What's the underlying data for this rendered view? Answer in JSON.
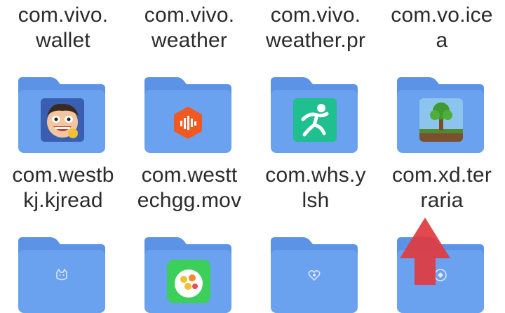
{
  "items": [
    {
      "label_l1": "com.vivo.",
      "label_l2": "wallet",
      "icon": "none"
    },
    {
      "label_l1": "com.vivo.",
      "label_l2": "weather",
      "icon": "none"
    },
    {
      "label_l1": "com.vivo.",
      "label_l2": "weather.pr",
      "icon": "none"
    },
    {
      "label_l1": "com.vo.ice",
      "label_l2": "a",
      "icon": "none"
    },
    {
      "label_l1": "com.westb",
      "label_l2": "kj.kjread",
      "icon": "cartoon-face-app-icon"
    },
    {
      "label_l1": "com.westt",
      "label_l2": "echgg.mov",
      "icon": "orange-podcast-app-icon"
    },
    {
      "label_l1": "com.whs.y",
      "label_l2": "lsh",
      "icon": "green-runner-app-icon"
    },
    {
      "label_l1": "com.xd.ter",
      "label_l2": "raria",
      "icon": "terraria-tree-app-icon"
    },
    {
      "label_l1": "",
      "label_l2": "",
      "icon": "cat-emblem-icon"
    },
    {
      "label_l1": "",
      "label_l2": "",
      "icon": "flower-app-icon"
    },
    {
      "label_l1": "",
      "label_l2": "",
      "icon": "heart-emblem-icon"
    },
    {
      "label_l1": "",
      "label_l2": "",
      "icon": "emblem-icon"
    }
  ],
  "colors": {
    "folder_front": "#6aa2f0",
    "folder_back": "#5b93e6",
    "label_text": "#2b2b2b",
    "arrow": "#e0393f"
  }
}
